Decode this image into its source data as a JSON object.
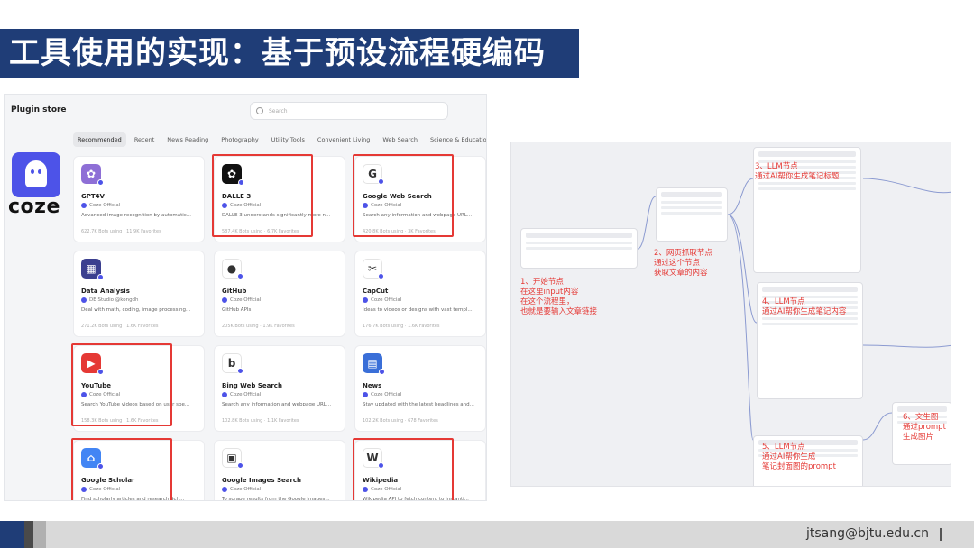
{
  "slide": {
    "title": "工具使用的实现：基于预设流程硬编码",
    "footer_email": "jtsang@bjtu.edu.cn"
  },
  "plugin_store": {
    "title": "Plugin store",
    "search_placeholder": "Search",
    "tabs": [
      "Recommended",
      "Recent",
      "News Reading",
      "Photography",
      "Utility Tools",
      "Convenient Living",
      "Web Search",
      "Science & Education"
    ],
    "active_tab": "Recommended",
    "logo_text": "coze",
    "cards": [
      {
        "name": "GPT4V",
        "owner": "Coze Official",
        "desc": "Advanced image recognition by automatic...",
        "stats": "622.7K Bots using · 11.9K Favorites",
        "icon": "openai-icon",
        "icon_color": "#8e6fd6",
        "icon_glyph": "✿",
        "highlight": false
      },
      {
        "name": "DALLE 3",
        "owner": "Coze Official",
        "desc": "DALLE 3 understands significantly more n...",
        "stats": "587.4K Bots using · 6.7K Favorites",
        "icon": "openai-icon",
        "icon_color": "#111111",
        "icon_glyph": "✿",
        "highlight": true
      },
      {
        "name": "Google Web Search",
        "owner": "Coze Official",
        "desc": "Search any information and webpage URL...",
        "stats": "420.8K Bots using · 3K Favorites",
        "icon": "google-icon",
        "icon_color": "#ffffff",
        "icon_glyph": "G",
        "highlight": true
      },
      {
        "name": "Data Analysis",
        "owner": "DE Studio @kongdh",
        "desc": "Deal with math, coding, image processing...",
        "stats": "271.2K Bots using · 1.6K Favorites",
        "icon": "data-analysis-icon",
        "icon_color": "#3b3f8f",
        "icon_glyph": "▦",
        "highlight": false
      },
      {
        "name": "GitHub",
        "owner": "Coze Official",
        "desc": "GitHub APIs",
        "stats": "205K Bots using · 1.9K Favorites",
        "icon": "github-icon",
        "icon_color": "#ffffff",
        "icon_glyph": "●",
        "highlight": false
      },
      {
        "name": "CapCut",
        "owner": "Coze Official",
        "desc": "Ideas to videos or designs with vast templ...",
        "stats": "176.7K Bots using · 1.6K Favorites",
        "icon": "capcut-icon",
        "icon_color": "#ffffff",
        "icon_glyph": "✂",
        "highlight": false
      },
      {
        "name": "YouTube",
        "owner": "Coze Official",
        "desc": "Search YouTube videos based on user spe...",
        "stats": "158.3K Bots using · 1.6K Favorites",
        "icon": "youtube-icon",
        "icon_color": "#e53935",
        "icon_glyph": "▶",
        "highlight": true
      },
      {
        "name": "Bing Web Search",
        "owner": "Coze Official",
        "desc": "Search any information and webpage URL...",
        "stats": "102.8K Bots using · 1.1K Favorites",
        "icon": "bing-icon",
        "icon_color": "#ffffff",
        "icon_glyph": "b",
        "highlight": false
      },
      {
        "name": "News",
        "owner": "Coze Official",
        "desc": "Stay updated with the latest headlines and...",
        "stats": "102.2K Bots using · 678 Favorites",
        "icon": "news-icon",
        "icon_color": "#3a6fd8",
        "icon_glyph": "▤",
        "highlight": false
      },
      {
        "name": "Google Scholar",
        "owner": "Coze Official",
        "desc": "Find scholarly articles and research Sch...",
        "stats": "",
        "icon": "scholar-icon",
        "icon_color": "#4285f4",
        "icon_glyph": "⌂",
        "highlight": true
      },
      {
        "name": "Google Images Search",
        "owner": "Coze Official",
        "desc": "To scrape results from the Google Images...",
        "stats": "",
        "icon": "google-images-icon",
        "icon_color": "#ffffff",
        "icon_glyph": "▣",
        "highlight": false
      },
      {
        "name": "Wikipedia",
        "owner": "Coze Official",
        "desc": "Wikipedia API to fetch content to instanti...",
        "stats": "",
        "icon": "wikipedia-icon",
        "icon_color": "#ffffff",
        "icon_glyph": "W",
        "highlight": true
      }
    ]
  },
  "workflow": {
    "labels": [
      {
        "id": "n1",
        "lines": [
          "1、开始节点",
          "在这里input内容",
          "在这个流程里，",
          "也就是要输入文章链接"
        ]
      },
      {
        "id": "n2",
        "lines": [
          "2、网页抓取节点",
          "通过这个节点",
          "获取文章的内容"
        ]
      },
      {
        "id": "n3",
        "lines": [
          "3、LLM节点",
          "通过AI帮你生成笔记标题"
        ]
      },
      {
        "id": "n4",
        "lines": [
          "4、LLM节点",
          "通过AI帮你生成笔记内容"
        ]
      },
      {
        "id": "n5",
        "lines": [
          "5、LLM节点",
          "通过AI帮你生成",
          "笔记封面图的prompt"
        ]
      },
      {
        "id": "n6",
        "lines": [
          "6、文生图",
          "通过prompt",
          "生成图片"
        ]
      }
    ]
  },
  "colors": {
    "banner": "#1f3d77",
    "highlight": "#e53935",
    "coze_brand": "#4d53e8"
  }
}
